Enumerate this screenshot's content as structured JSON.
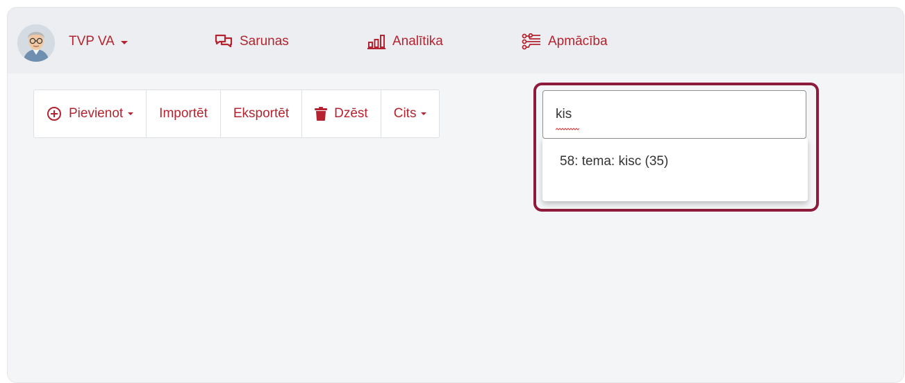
{
  "navbar": {
    "user_label": "TVP VA",
    "links": [
      {
        "label": "Sarunas",
        "icon": "chat-bubbles-icon"
      },
      {
        "label": "Analītika",
        "icon": "bar-chart-icon"
      },
      {
        "label": "Apmācība",
        "icon": "circuit-icon"
      }
    ]
  },
  "toolbar": {
    "add_label": "Pievienot",
    "import_label": "Importēt",
    "export_label": "Eksportēt",
    "delete_label": "Dzēst",
    "other_label": "Cits"
  },
  "search": {
    "value": "kis",
    "suggestions": [
      "58: tema: kisc (35)"
    ]
  },
  "colors": {
    "accent": "#b4232f",
    "highlight_border": "#8e1b3b",
    "navbar_bg": "#eceef1",
    "page_bg": "#f4f5f7"
  }
}
